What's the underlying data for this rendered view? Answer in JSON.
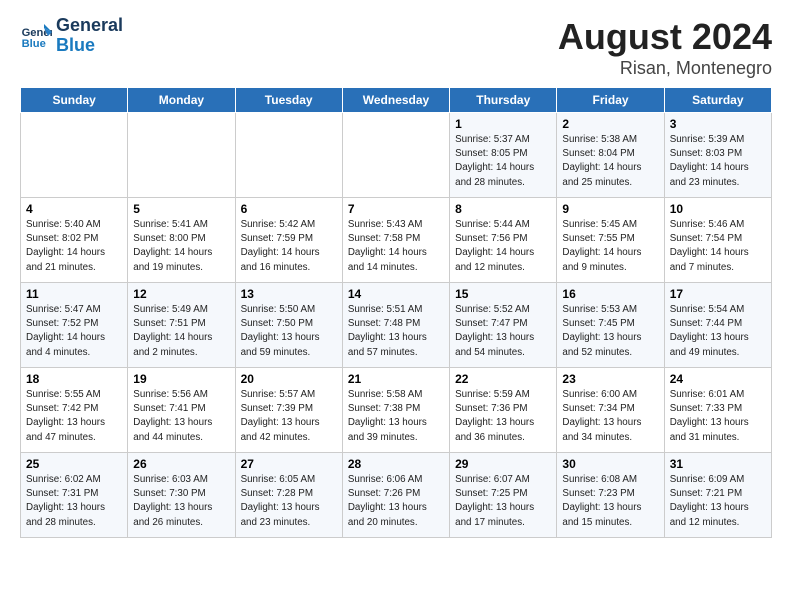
{
  "header": {
    "logo_general": "General",
    "logo_blue": "Blue",
    "main_title": "August 2024",
    "subtitle": "Risan, Montenegro"
  },
  "days_of_week": [
    "Sunday",
    "Monday",
    "Tuesday",
    "Wednesday",
    "Thursday",
    "Friday",
    "Saturday"
  ],
  "weeks": [
    [
      {
        "day": "",
        "info": ""
      },
      {
        "day": "",
        "info": ""
      },
      {
        "day": "",
        "info": ""
      },
      {
        "day": "",
        "info": ""
      },
      {
        "day": "1",
        "info": "Sunrise: 5:37 AM\nSunset: 8:05 PM\nDaylight: 14 hours\nand 28 minutes."
      },
      {
        "day": "2",
        "info": "Sunrise: 5:38 AM\nSunset: 8:04 PM\nDaylight: 14 hours\nand 25 minutes."
      },
      {
        "day": "3",
        "info": "Sunrise: 5:39 AM\nSunset: 8:03 PM\nDaylight: 14 hours\nand 23 minutes."
      }
    ],
    [
      {
        "day": "4",
        "info": "Sunrise: 5:40 AM\nSunset: 8:02 PM\nDaylight: 14 hours\nand 21 minutes."
      },
      {
        "day": "5",
        "info": "Sunrise: 5:41 AM\nSunset: 8:00 PM\nDaylight: 14 hours\nand 19 minutes."
      },
      {
        "day": "6",
        "info": "Sunrise: 5:42 AM\nSunset: 7:59 PM\nDaylight: 14 hours\nand 16 minutes."
      },
      {
        "day": "7",
        "info": "Sunrise: 5:43 AM\nSunset: 7:58 PM\nDaylight: 14 hours\nand 14 minutes."
      },
      {
        "day": "8",
        "info": "Sunrise: 5:44 AM\nSunset: 7:56 PM\nDaylight: 14 hours\nand 12 minutes."
      },
      {
        "day": "9",
        "info": "Sunrise: 5:45 AM\nSunset: 7:55 PM\nDaylight: 14 hours\nand 9 minutes."
      },
      {
        "day": "10",
        "info": "Sunrise: 5:46 AM\nSunset: 7:54 PM\nDaylight: 14 hours\nand 7 minutes."
      }
    ],
    [
      {
        "day": "11",
        "info": "Sunrise: 5:47 AM\nSunset: 7:52 PM\nDaylight: 14 hours\nand 4 minutes."
      },
      {
        "day": "12",
        "info": "Sunrise: 5:49 AM\nSunset: 7:51 PM\nDaylight: 14 hours\nand 2 minutes."
      },
      {
        "day": "13",
        "info": "Sunrise: 5:50 AM\nSunset: 7:50 PM\nDaylight: 13 hours\nand 59 minutes."
      },
      {
        "day": "14",
        "info": "Sunrise: 5:51 AM\nSunset: 7:48 PM\nDaylight: 13 hours\nand 57 minutes."
      },
      {
        "day": "15",
        "info": "Sunrise: 5:52 AM\nSunset: 7:47 PM\nDaylight: 13 hours\nand 54 minutes."
      },
      {
        "day": "16",
        "info": "Sunrise: 5:53 AM\nSunset: 7:45 PM\nDaylight: 13 hours\nand 52 minutes."
      },
      {
        "day": "17",
        "info": "Sunrise: 5:54 AM\nSunset: 7:44 PM\nDaylight: 13 hours\nand 49 minutes."
      }
    ],
    [
      {
        "day": "18",
        "info": "Sunrise: 5:55 AM\nSunset: 7:42 PM\nDaylight: 13 hours\nand 47 minutes."
      },
      {
        "day": "19",
        "info": "Sunrise: 5:56 AM\nSunset: 7:41 PM\nDaylight: 13 hours\nand 44 minutes."
      },
      {
        "day": "20",
        "info": "Sunrise: 5:57 AM\nSunset: 7:39 PM\nDaylight: 13 hours\nand 42 minutes."
      },
      {
        "day": "21",
        "info": "Sunrise: 5:58 AM\nSunset: 7:38 PM\nDaylight: 13 hours\nand 39 minutes."
      },
      {
        "day": "22",
        "info": "Sunrise: 5:59 AM\nSunset: 7:36 PM\nDaylight: 13 hours\nand 36 minutes."
      },
      {
        "day": "23",
        "info": "Sunrise: 6:00 AM\nSunset: 7:34 PM\nDaylight: 13 hours\nand 34 minutes."
      },
      {
        "day": "24",
        "info": "Sunrise: 6:01 AM\nSunset: 7:33 PM\nDaylight: 13 hours\nand 31 minutes."
      }
    ],
    [
      {
        "day": "25",
        "info": "Sunrise: 6:02 AM\nSunset: 7:31 PM\nDaylight: 13 hours\nand 28 minutes."
      },
      {
        "day": "26",
        "info": "Sunrise: 6:03 AM\nSunset: 7:30 PM\nDaylight: 13 hours\nand 26 minutes."
      },
      {
        "day": "27",
        "info": "Sunrise: 6:05 AM\nSunset: 7:28 PM\nDaylight: 13 hours\nand 23 minutes."
      },
      {
        "day": "28",
        "info": "Sunrise: 6:06 AM\nSunset: 7:26 PM\nDaylight: 13 hours\nand 20 minutes."
      },
      {
        "day": "29",
        "info": "Sunrise: 6:07 AM\nSunset: 7:25 PM\nDaylight: 13 hours\nand 17 minutes."
      },
      {
        "day": "30",
        "info": "Sunrise: 6:08 AM\nSunset: 7:23 PM\nDaylight: 13 hours\nand 15 minutes."
      },
      {
        "day": "31",
        "info": "Sunrise: 6:09 AM\nSunset: 7:21 PM\nDaylight: 13 hours\nand 12 minutes."
      }
    ]
  ]
}
